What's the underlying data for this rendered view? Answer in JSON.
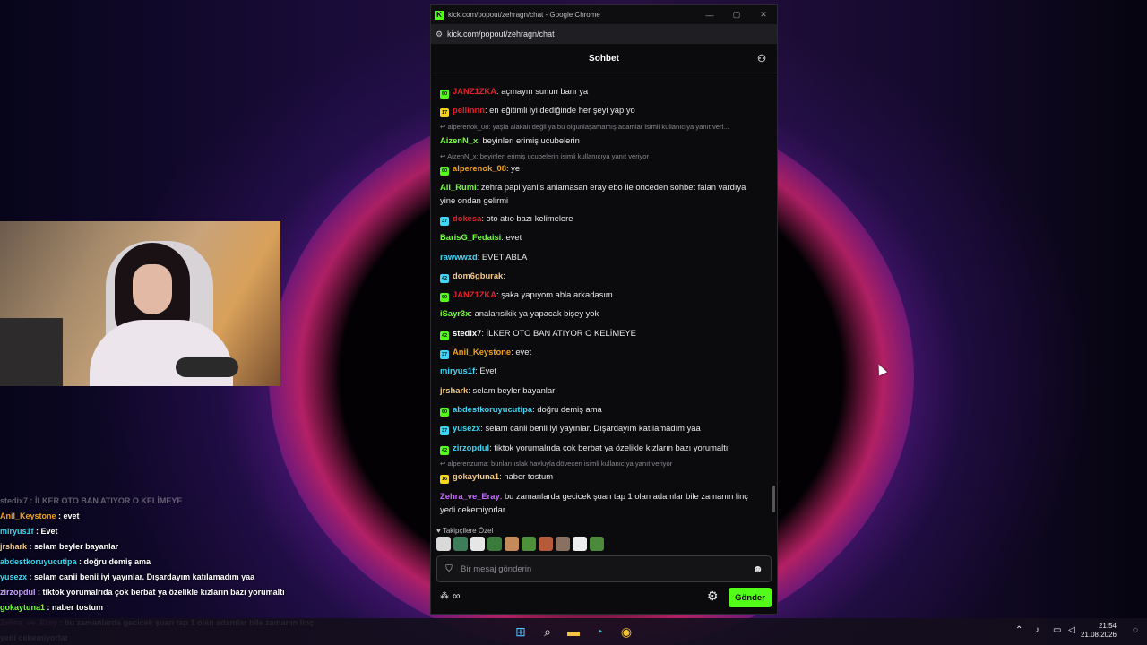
{
  "window": {
    "title": "kick.com/popout/zehragn/chat - Google Chrome",
    "address": "kick.com/popout/zehragn/chat",
    "logo_letter": "K"
  },
  "chat": {
    "header_title": "Sohbet",
    "messages": [
      {
        "user": "JANZ1ZKA",
        "text": "açmayın sunun banı ya",
        "color": "#e1202a",
        "badge": "60",
        "badge_color": "#53fc18"
      },
      {
        "user": "pellinnn",
        "text": "en eğitimli iyi dediğinde her şeyi yapıyo",
        "color": "#e1202a",
        "badge": "17",
        "badge_color": "#f7d51c"
      },
      {
        "reply": "alperenok_08: yaşla alakalı değil ya bu olgunlaşamamış adamlar isimli kullanıcıya yanıt veri..."
      },
      {
        "user": "AizenN_x",
        "text": "beyinleri erimiş ucubelerin",
        "color": "#72ff3e"
      },
      {
        "reply": "AizenN_x: beyinleri erimiş ucubelerin isimli kullanıcıya yanıt veriyor"
      },
      {
        "user": "alperenok_08",
        "text": "ye",
        "color": "#f0a020",
        "badge": "60",
        "badge_color": "#53fc18"
      },
      {
        "user": "Ali_Rumi",
        "text": "zehra papi yanlis anlamasan eray ebo ile onceden sohbet falan vardıya yine ondan gelirmi",
        "color": "#72ff3e"
      },
      {
        "user": "dokesa",
        "text": "oto atıo bazı kelimelere",
        "color": "#e1202a",
        "badge": "37",
        "badge_color": "#3dd6f5"
      },
      {
        "user": "BarisG_Fedaisi",
        "text": "evet",
        "color": "#72ff3e"
      },
      {
        "user": "rawwwxd",
        "text": "EVET ABLA",
        "color": "#3dd6f5"
      },
      {
        "user": "dom6gburak",
        "text": "",
        "color": "#f4c98a",
        "badge": "42",
        "badge_color": "#3dd6f5"
      },
      {
        "user": "JANZ1ZKA",
        "text": "şaka yapıyom abla arkadasım",
        "color": "#e1202a",
        "badge": "60",
        "badge_color": "#53fc18"
      },
      {
        "user": "iSayr3x",
        "text": "analarısikik ya yapacak bişey yok",
        "color": "#72ff3e"
      },
      {
        "user": "stedix7",
        "text": "İLKER OTO BAN ATIYOR O KELİMEYE",
        "color": "#ffffff",
        "badge": "42",
        "badge_color": "#53fc18"
      },
      {
        "user": "Anil_Keystone",
        "text": "evet",
        "color": "#f0a020",
        "badge": "37",
        "badge_color": "#3dd6f5"
      },
      {
        "user": "miryus1f",
        "text": "Evet",
        "color": "#3dd6f5"
      },
      {
        "user": "jrshark",
        "text": "selam beyler bayanlar",
        "color": "#f4c98a"
      },
      {
        "user": "abdestkoruyucutipa",
        "text": "doğru demiş ama",
        "color": "#3dd6f5",
        "badge": "60",
        "badge_color": "#53fc18"
      },
      {
        "user": "yusezx",
        "text": "selam canii benii iyi yayınlar. Dışardayım katılamadım yaa",
        "color": "#3dd6f5",
        "badge": "37",
        "badge_color": "#3dd6f5"
      },
      {
        "user": "zirzopdul",
        "text": "tiktok yorumalrıda çok berbat ya özelikle kızların bazı yorumaltı",
        "color": "#3dd6f5",
        "badge": "42",
        "badge_color": "#53fc18"
      },
      {
        "reply": "alperenzurna: bunları ıslak havluyla dövecen isimli kullanıcıya yanıt veriyor"
      },
      {
        "user": "gokaytuna1",
        "text": "naber tostum",
        "color": "#f4c98a",
        "badge": "16",
        "badge_color": "#f7d51c"
      },
      {
        "user": "Zehra_ve_Eray",
        "text": "bu zamanlarda gecicek şuan tap 1 olan adamlar bile zamanın linç yedi cekemiyorlar",
        "color": "#c86bff"
      }
    ],
    "emotes_label": "Takipçilere Özel",
    "input_placeholder": "Bir mesaj gönderin",
    "send_label": "Gönder"
  },
  "overlay": {
    "lines": [
      {
        "user": "stedix7",
        "text": "İLKER OTO BAN ATIYOR O KELİMEYE",
        "color": "#ffffff",
        "dim": true
      },
      {
        "user": "Anil_Keystone",
        "text": "evet",
        "color": "#f0a020"
      },
      {
        "user": "miryus1f",
        "text": "Evet",
        "color": "#3dd6f5"
      },
      {
        "user": "jrshark",
        "text": "selam beyler bayanlar",
        "color": "#f4c98a"
      },
      {
        "user": "abdestkoruyucutipa",
        "text": "doğru demiş ama",
        "color": "#3dd6f5"
      },
      {
        "user": "yusezx",
        "text": "selam canii benii iyi yayınlar. Dışardayım katılamadım yaa",
        "color": "#3dd6f5"
      },
      {
        "user": "zirzopdul",
        "text": "tiktok yorumalrıda çok berbat ya özelikle kızların bazı yorumaltı",
        "color": "#c9a0ff"
      },
      {
        "user": "gokaytuna1",
        "text": "naber tostum",
        "color": "#72ff3e"
      },
      {
        "user": "Zehra_ve_Eray",
        "text": "bu zamanlarda gecicek şuan tap 1 olan adamlar bile zamanın linç",
        "color": "#c86bff"
      },
      {
        "user": "",
        "text": "yedi cekemiyorlar",
        "color": "#ffffff"
      }
    ]
  },
  "taskbar": {
    "time": "21:54",
    "date": "21.08.2026"
  }
}
